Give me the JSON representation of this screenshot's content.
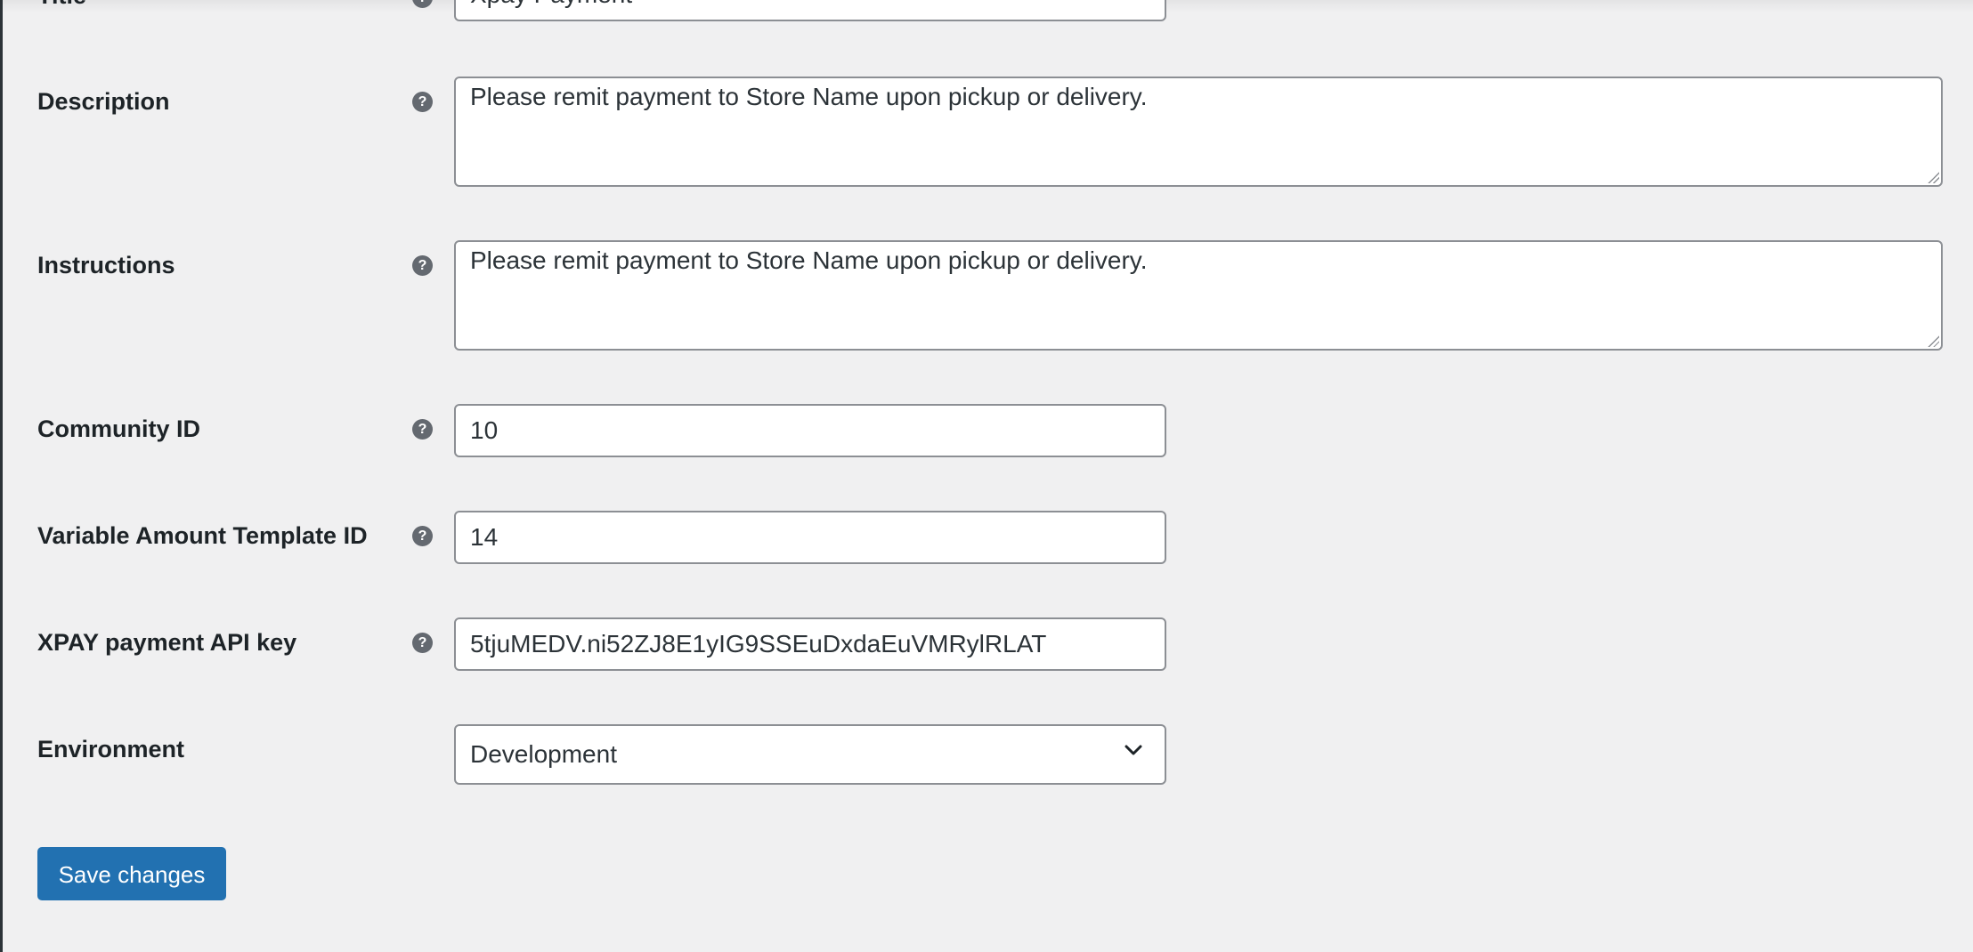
{
  "fields": [
    {
      "key": "title",
      "label": "Title",
      "value": "Xpay Payment",
      "help_icon": "help-icon"
    },
    {
      "key": "description",
      "label": "Description",
      "value": "Please remit payment to Store Name upon pickup or delivery.",
      "help_icon": "help-icon"
    },
    {
      "key": "instructions",
      "label": "Instructions",
      "value": "Please remit payment to Store Name upon pickup or delivery.",
      "help_icon": "help-icon"
    },
    {
      "key": "community_id",
      "label": "Community ID",
      "value": "10",
      "help_icon": "help-icon"
    },
    {
      "key": "variable_amount_template_id",
      "label": "Variable Amount Template ID",
      "value": "14",
      "help_icon": "help-icon"
    },
    {
      "key": "xpay_api_key",
      "label": "XPAY payment API key",
      "value": "5tjuMEDV.ni52ZJ8E1yIG9SSEuDxdaEuVMRylRLAT",
      "help_icon": "help-icon"
    },
    {
      "key": "environment",
      "label": "Environment",
      "value": "Development"
    }
  ],
  "help_glyph": "?",
  "save_label": "Save changes",
  "colors": {
    "background": "#f0f0f1",
    "primary_button": "#2271b1",
    "help_icon": "#646970",
    "field_border": "#8c8f94"
  }
}
